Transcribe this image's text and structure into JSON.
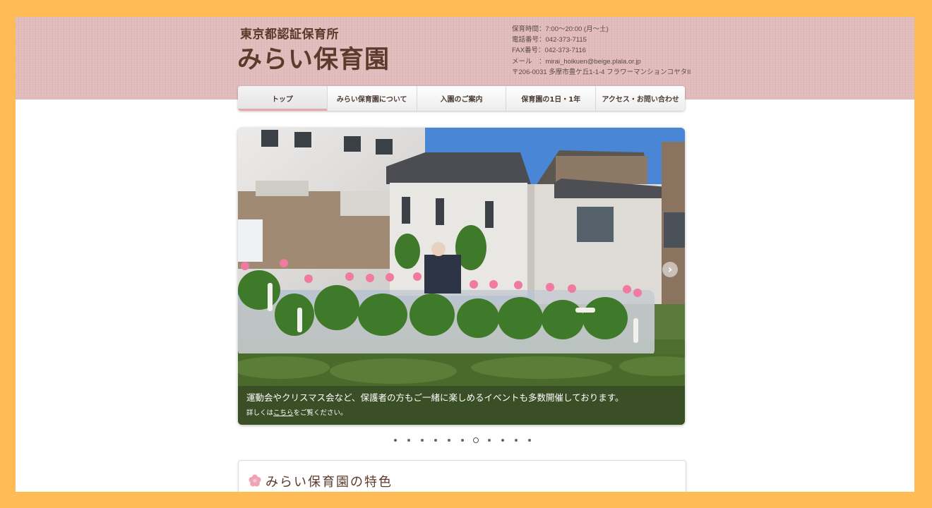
{
  "header": {
    "logo_sub": "東京都認証保育所",
    "logo_main": "みらい保育園",
    "info": [
      "保育時間：7:00〜20:00 (月〜土)",
      "電話番号：042-373-7115",
      "FAX番号：042-373-7116",
      "メール　：mirai_hoikuen@beige.plala.or.jp",
      "〒206-0031 多摩市豊ケ丘1-1-4 フラワーマンションコヤタII"
    ]
  },
  "nav": [
    {
      "label": "トップ",
      "active": true
    },
    {
      "label": "みらい保育園について",
      "active": false
    },
    {
      "label": "入園のご案内",
      "active": false
    },
    {
      "label": "保育園の1日・1年",
      "active": false
    },
    {
      "label": "アクセス・お問い合わせ",
      "active": false
    }
  ],
  "slider": {
    "caption": "運動会やクリスマス会など、保護者の方もご一緒に楽しめるイベントも多数開催しております。",
    "sub_prefix": "詳しくは",
    "sub_link": "こちら",
    "sub_suffix": "をご覧ください。",
    "next_icon": "chevron-right-icon",
    "dot_count": 11,
    "active_dot": 6
  },
  "feature": {
    "title": "みらい保育園の特色",
    "icon": "flower-icon"
  },
  "colors": {
    "page_bg": "#FFBB55",
    "header_band": "#e2bcbd",
    "brand_brown": "#5b3b2b",
    "nav_accent": "#e8a6b0"
  }
}
